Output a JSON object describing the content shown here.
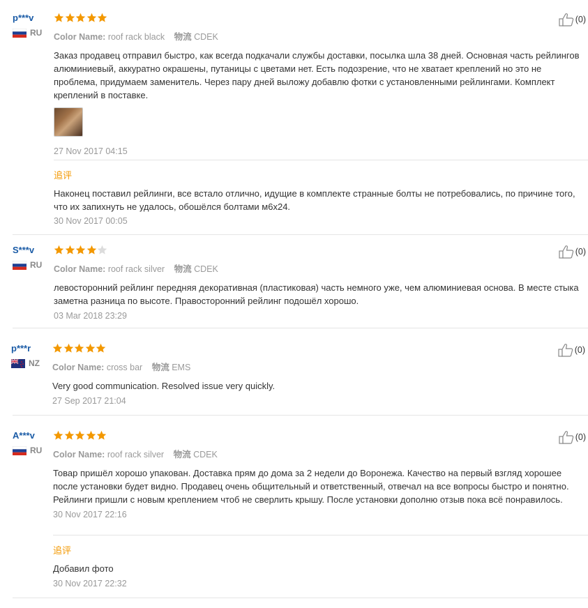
{
  "reviews": [
    {
      "user": "p***v",
      "country": "RU",
      "rating": 5,
      "color_label": "Color Name:",
      "color_value": "roof rack black",
      "shipping_label": "物流",
      "shipping_value": "CDEK",
      "text": "Заказ продавец отправил быстро, как всегда подкачали службы доставки, посылка шла 38 дней. Основная часть рейлингов алюминиевый, аккуратно окрашены, путаницы с цветами нет. Есть подозрение, что не хватает креплений но это не проблема, придумаем заменитель. Через пару дней выложу добавлю фотки с установленными рейлингами. Комплект креплений в поставке.",
      "date": "27 Nov 2017 04:15",
      "helpful": "(0)",
      "followup_label": "追评",
      "followup_text": "Наконец поставил рейлинги, все встало отлично, идущие в комплекте странные болты не потребовались, по причине того, что их запихнуть не удалось, обошёлся болтами м6х24.",
      "followup_date": "30 Nov 2017 00:05"
    },
    {
      "user": "S***v",
      "country": "RU",
      "rating": 4,
      "color_label": "Color Name:",
      "color_value": "roof rack silver",
      "shipping_label": "物流",
      "shipping_value": "CDEK",
      "text": "левосторонний рейлинг передняя декоративная (пластиковая) часть немного уже, чем алюминиевая основа. В месте стыка заметна разница по высоте. Правосторонний рейлинг подошёл хорошо.",
      "date": "03 Mar 2018 23:29",
      "helpful": "(0)"
    },
    {
      "user": "p***r",
      "country": "NZ",
      "rating": 5,
      "color_label": "Color Name:",
      "color_value": "cross bar",
      "shipping_label": "物流",
      "shipping_value": "EMS",
      "text": "Very good communication. Resolved issue very quickly.",
      "date": "27 Sep 2017 21:04",
      "helpful": "(0)"
    },
    {
      "user": "A***v",
      "country": "RU",
      "rating": 5,
      "color_label": "Color Name:",
      "color_value": "roof rack silver",
      "shipping_label": "物流",
      "shipping_value": "CDEK",
      "text": "Товар пришёл хорошо упакован. Доставка прям до дома за 2 недели до Воронежа. Качество на первый взгляд хорошее после установки будет видно. Продавец очень общительный и ответственный, отвечал на все вопросы быстро и понятно. Рейлинги пришли с новым креплением чтоб не сверлить крышу. После установки дополню отзыв пока всё понравилось.",
      "date": "30 Nov 2017 22:16",
      "helpful": "(0)",
      "followup_label": "追评",
      "followup_text": "Добавил фото",
      "followup_date": "30 Nov 2017 22:32"
    }
  ],
  "colors": {
    "star_on": "#f39800",
    "star_off": "#dcdcdc",
    "user": "#1a5ba6",
    "followup": "#f39800"
  },
  "icons": {
    "thumb": "thumb-up-icon",
    "star": "star-icon",
    "flag_ru": "flag-ru-icon",
    "flag_nz": "flag-nz-icon"
  }
}
